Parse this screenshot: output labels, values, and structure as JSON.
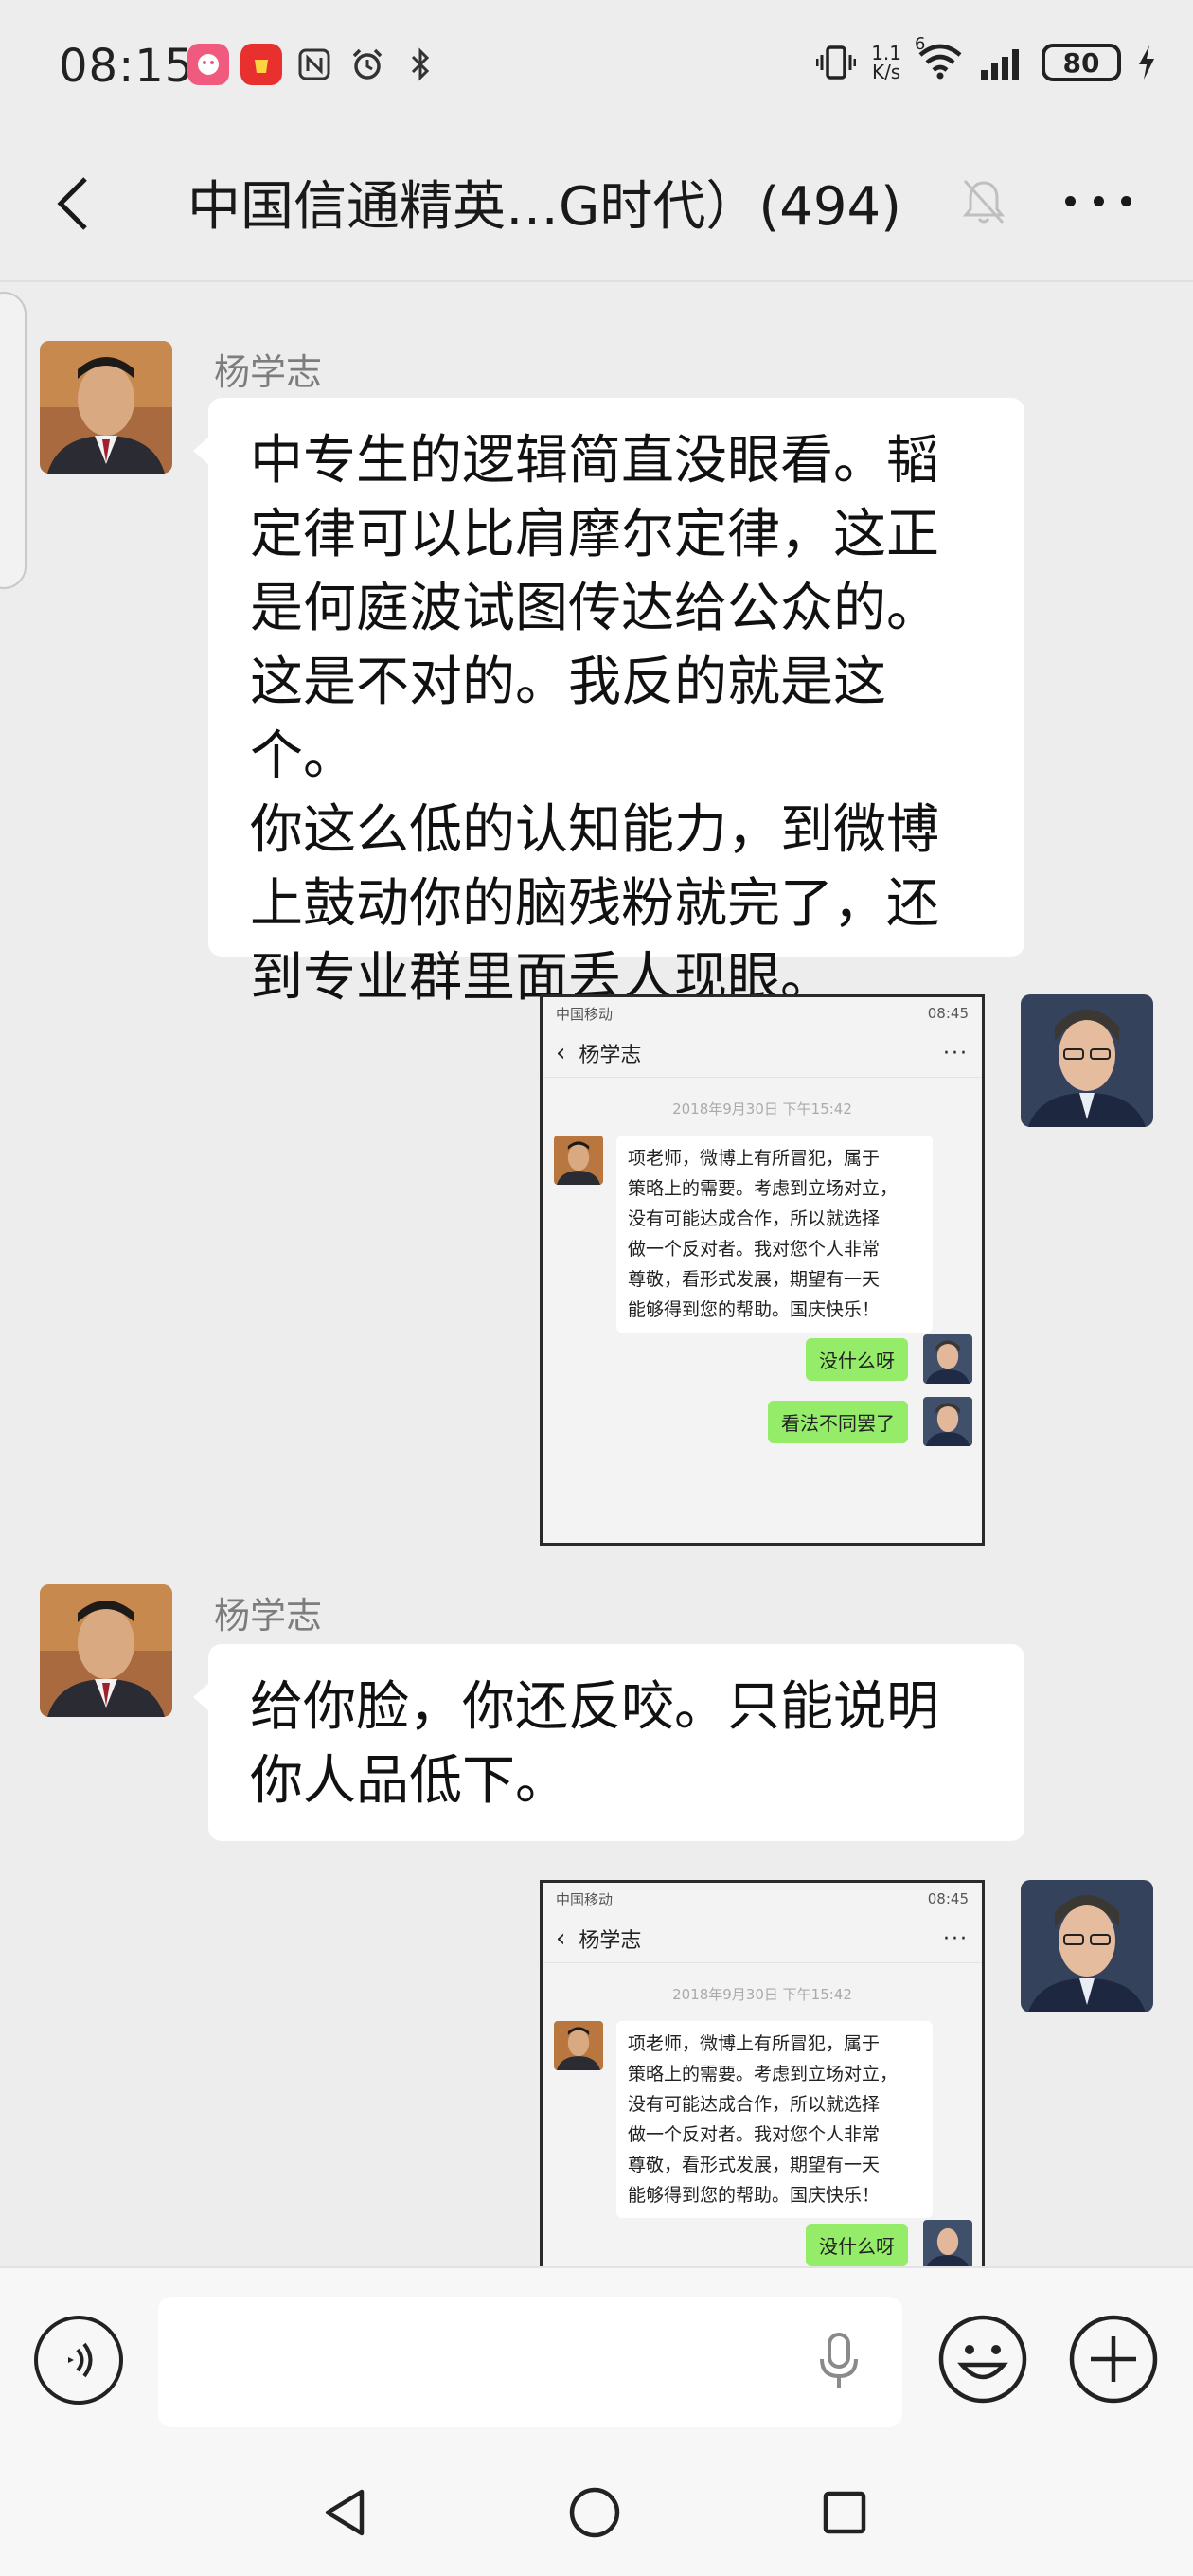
{
  "status": {
    "time": "08:15",
    "speed_top": "1.1",
    "speed_bottom": "K/s",
    "network_tag": "6",
    "battery": "80"
  },
  "header": {
    "title": "中国信通精英…G时代）(494)"
  },
  "messages": [
    {
      "sender": "杨学志",
      "text": "中专生的逻辑简直没眼看。韬\n定律可以比肩摩尔定律，这正\n是何庭波试图传达给公众的。\n这是不对的。我反的就是这个。\n你这么低的认知能力，到微博\n上鼓动你的脑残粉就完了，还\n到专业群里面丢人现眼。"
    },
    {
      "sender": "杨学志",
      "text": "给你脸，你还反咬。只能说明\n你人品低下。"
    }
  ],
  "screenshot": {
    "carrier": "中国移动",
    "status_time": "08:45",
    "contact": "杨学志",
    "date": "2018年9月30日 下午15:42",
    "message_lines": [
      "项老师，微博上有所冒犯，属于",
      "策略上的需要。考虑到立场对立，",
      "没有可能达成合作，所以就选择",
      "做一个反对者。我对您个人非常",
      "尊敬，看形式发展，期望有一天",
      "能够得到您的帮助。国庆快乐！"
    ],
    "reply1": "没什么呀",
    "reply2": "看法不同罢了",
    "partial_reply": "没什么呀"
  },
  "input": {
    "placeholder": ""
  },
  "colors": {
    "background": "#ededed",
    "bubble": "#ffffff",
    "sent_bubble": "#95ec69",
    "accent": "#07c160"
  }
}
